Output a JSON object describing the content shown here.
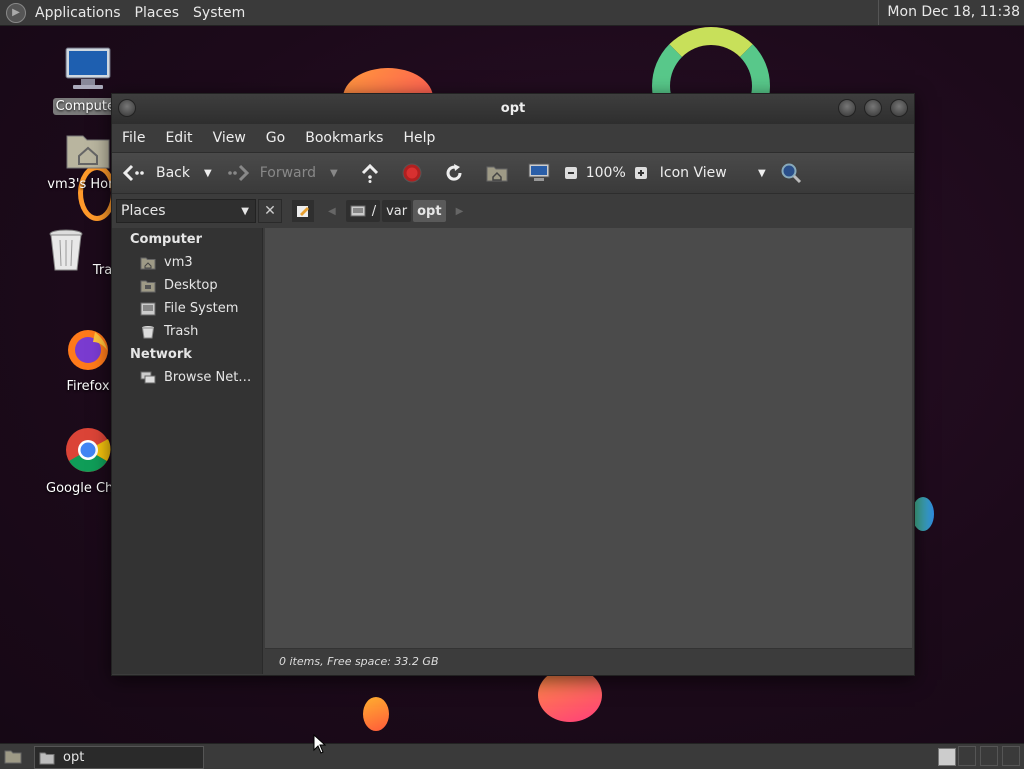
{
  "top_panel": {
    "menus": [
      "Applications",
      "Places",
      "System"
    ],
    "clock": "Mon Dec 18, 11:38"
  },
  "desktop": {
    "icons": [
      {
        "label": "Computer",
        "icon": "computer-icon",
        "selected": true
      },
      {
        "label": "vm3's Home",
        "icon": "home-folder-icon"
      },
      {
        "label": "Trash",
        "icon": "trash-icon"
      },
      {
        "label": "Firefox",
        "icon": "firefox-icon"
      },
      {
        "label": "Google Chrome",
        "icon": "chrome-icon"
      }
    ]
  },
  "window": {
    "title": "opt",
    "menu": [
      "File",
      "Edit",
      "View",
      "Go",
      "Bookmarks",
      "Help"
    ],
    "toolbar": {
      "back": "Back",
      "forward": "Forward",
      "zoom": "100%",
      "view_mode": "Icon View"
    },
    "sidebar": {
      "selector": "Places",
      "sections": [
        {
          "title": "Computer",
          "items": [
            "vm3",
            "Desktop",
            "File System",
            "Trash"
          ]
        },
        {
          "title": "Network",
          "items": [
            "Browse Net…"
          ]
        }
      ]
    },
    "path": [
      "/",
      "var",
      "opt"
    ],
    "status": "0 items, Free space: 33.2 GB"
  },
  "taskbar": {
    "tasks": [
      {
        "label": "opt"
      }
    ]
  },
  "colors": {
    "panel": "#3a3a3a",
    "window_bg": "#3c3c3c",
    "content_bg": "#4b4b4b",
    "desktop_bg": "#1d0b1b"
  }
}
